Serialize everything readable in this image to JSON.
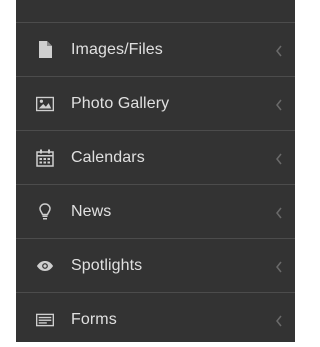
{
  "sidebar": {
    "items": [
      {
        "label": "Images/Files",
        "icon": "file-icon"
      },
      {
        "label": "Photo Gallery",
        "icon": "image-icon"
      },
      {
        "label": "Calendars",
        "icon": "calendar-icon"
      },
      {
        "label": "News",
        "icon": "lightbulb-icon"
      },
      {
        "label": "Spotlights",
        "icon": "eye-icon"
      },
      {
        "label": "Forms",
        "icon": "form-icon"
      }
    ]
  },
  "colors": {
    "background": "#333333",
    "divider": "#4c4c4c",
    "text": "#e0e0e0",
    "icon": "#cfcfcf",
    "chevron": "#6a6a6a"
  }
}
